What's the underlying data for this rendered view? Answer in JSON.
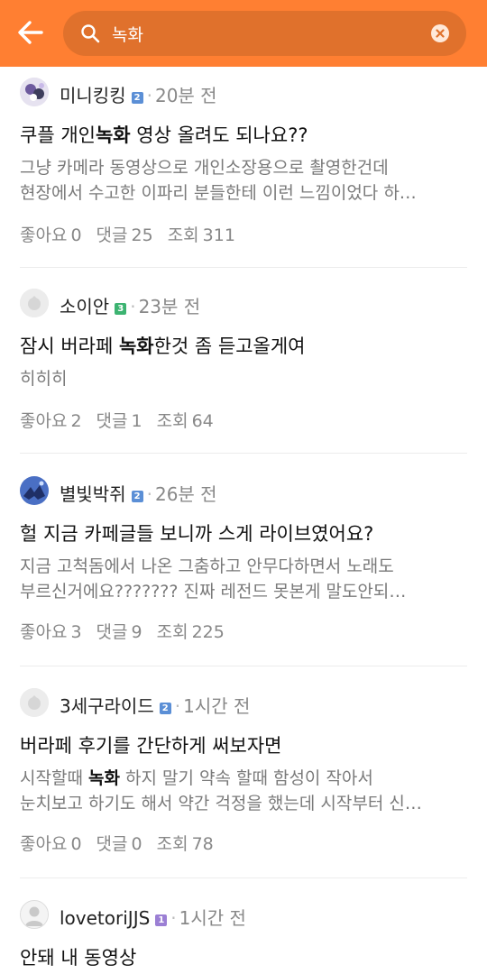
{
  "colors": {
    "header_bg": "#ff7f32",
    "search_bg": "#e0712c",
    "level_blue": "#5b8fd6",
    "level_green": "#3cb371",
    "level_purple": "#9b7fd4"
  },
  "header": {
    "back_icon": "arrow-left-icon",
    "search_icon": "search-icon",
    "search_value": "녹화",
    "clear_icon": "clear-icon"
  },
  "posts": [
    {
      "nickname": "미니킹킹",
      "level": "2",
      "time": "20분 전",
      "title_pre": "쿠플 개인",
      "title_kw": "녹화",
      "title_post": " 영상 올려도 되나요??",
      "body_l1": "그냥 카메라 동영상으로 개인소장용으로 촬영한건데",
      "body_l2": "현장에서 수고한 이파리 분들한테 이런 느낌이었다 하…",
      "likes_label": "좋아요",
      "likes": "0",
      "comments_label": "댓글",
      "comments": "25",
      "views_label": "조회",
      "views": "311"
    },
    {
      "nickname": "소이안",
      "level": "3",
      "time": "23분 전",
      "title_pre": "잠시 버라페 ",
      "title_kw": "녹화",
      "title_post": "한것 좀 듣고올게여",
      "body_l1": "히히히",
      "likes_label": "좋아요",
      "likes": "2",
      "comments_label": "댓글",
      "comments": "1",
      "views_label": "조회",
      "views": "64"
    },
    {
      "nickname": "별빛박쥐",
      "level": "2",
      "time": "26분 전",
      "title": "헐 지금 카페글들 보니까 스게 라이브였어요?",
      "body_l1": "지금 고척돔에서 나온 그춤하고 안무다하면서 노래도",
      "body_l2": "부르신거에요??????? 진짜 레전드 못본게 말도안되…",
      "likes_label": "좋아요",
      "likes": "3",
      "comments_label": "댓글",
      "comments": "9",
      "views_label": "조회",
      "views": "225"
    },
    {
      "nickname": "3세구라이드",
      "level": "2",
      "time": "1시간 전",
      "title": "버라페 후기를 간단하게 써보자면",
      "body_l1_pre": "시작할때 ",
      "body_l1_kw": "녹화",
      "body_l1_post": " 하지 말기 약속 할때 함성이 작아서",
      "body_l2": "눈치보고 하기도 해서 약간 걱정을 했는데 시작부터 신…",
      "likes_label": "좋아요",
      "likes": "0",
      "comments_label": "댓글",
      "comments": "0",
      "views_label": "조회",
      "views": "78"
    },
    {
      "nickname": "lovetoriJJS",
      "level": "1",
      "time": "1시간 전",
      "title": "안돼 내 동영상"
    }
  ]
}
